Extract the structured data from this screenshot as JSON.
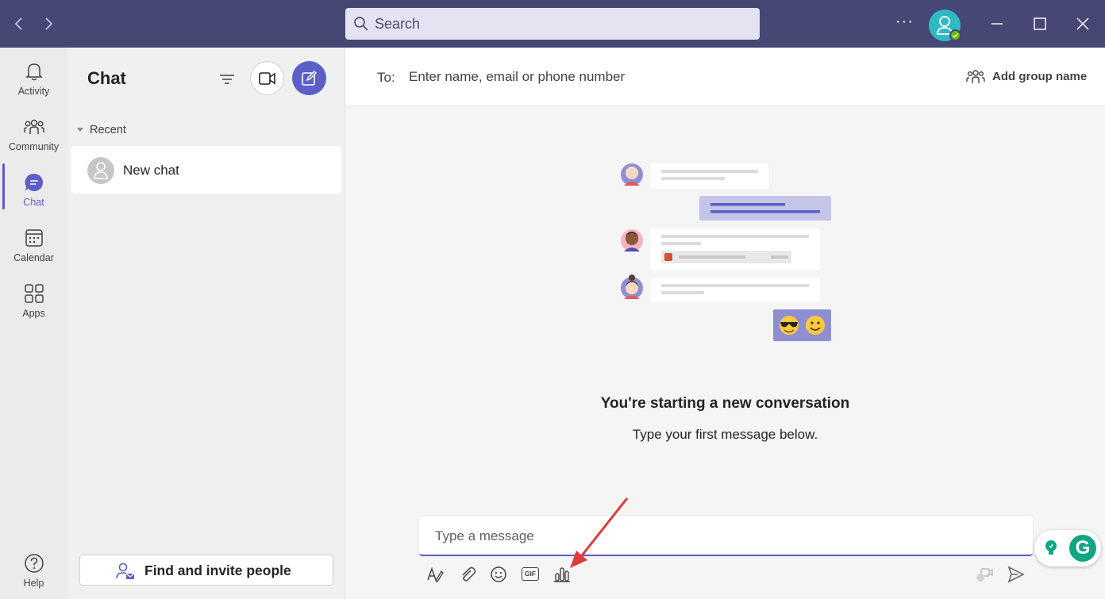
{
  "titlebar": {
    "search_placeholder": "Search",
    "more_label": "···"
  },
  "rail": {
    "items": [
      {
        "label": "Activity",
        "icon": "bell-icon"
      },
      {
        "label": "Community",
        "icon": "community-icon"
      },
      {
        "label": "Chat",
        "icon": "chat-icon",
        "active": true
      },
      {
        "label": "Calendar",
        "icon": "calendar-icon"
      },
      {
        "label": "Apps",
        "icon": "apps-icon"
      }
    ],
    "help_label": "Help"
  },
  "chat_list": {
    "title": "Chat",
    "recent_label": "Recent",
    "items": [
      {
        "label": "New chat"
      }
    ],
    "find_invite_label": "Find and invite people"
  },
  "main": {
    "to_label": "To:",
    "to_placeholder": "Enter name, email or phone number",
    "add_group_label": "Add group name",
    "heading": "You're starting a new conversation",
    "subheading": "Type your first message below.",
    "composer_placeholder": "Type a message",
    "gif_label": "GIF"
  },
  "colors": {
    "titlebar": "#464775",
    "accent": "#5b5fc7",
    "avatar": "#2fb9c5",
    "presence": "#6bb700",
    "grammarly": "#11a683",
    "annotation_arrow": "#e03a3a"
  }
}
